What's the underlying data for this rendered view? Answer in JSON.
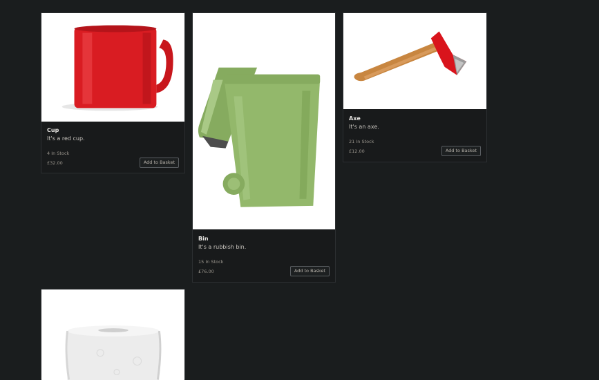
{
  "products": [
    {
      "title": "Cup",
      "description": "It's a red cup.",
      "stock": "4 In Stock",
      "price": "£32.00",
      "button_label": "Add to Basket"
    },
    {
      "title": "Bin",
      "description": "It's a rubbish bin.",
      "stock": "15 In Stock",
      "price": "£76.00",
      "button_label": "Add to Basket"
    },
    {
      "title": "Axe",
      "description": "It's an axe.",
      "stock": "21 In Stock",
      "price": "£12.00",
      "button_label": "Add to Basket"
    },
    {
      "title": "",
      "description": "",
      "stock": "",
      "price": "",
      "button_label": ""
    }
  ],
  "colors": {
    "page_background": "#1a1d1e",
    "card_background": "#181a1b",
    "cup_red": "#d91c22",
    "bin_green": "#93b86b",
    "axe_red": "#d9141c",
    "axe_handle": "#c88640"
  }
}
